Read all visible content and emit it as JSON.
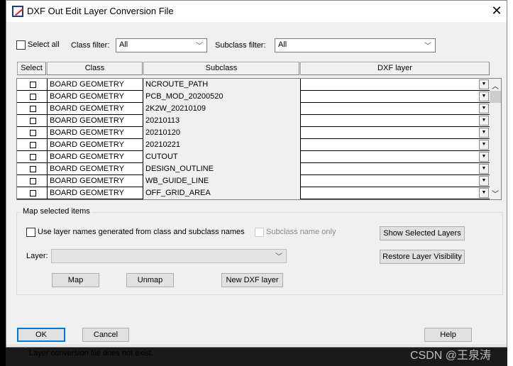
{
  "window": {
    "title": "DXF Out Edit Layer Conversion File",
    "close": "✕"
  },
  "filters": {
    "select_all": "Select all",
    "class_label": "Class filter:",
    "class_value": "All",
    "subclass_label": "Subclass filter:",
    "subclass_value": "All"
  },
  "table": {
    "headers": [
      "Select",
      "Class",
      "Subclass",
      "DXF layer"
    ],
    "rows": [
      {
        "class": "BOARD GEOMETRY",
        "subclass": "NCROUTE_PATH",
        "dxf": ""
      },
      {
        "class": "BOARD GEOMETRY",
        "subclass": "PCB_MOD_20200520",
        "dxf": ""
      },
      {
        "class": "BOARD GEOMETRY",
        "subclass": "2K2W_20210109",
        "dxf": ""
      },
      {
        "class": "BOARD GEOMETRY",
        "subclass": "20210113",
        "dxf": ""
      },
      {
        "class": "BOARD GEOMETRY",
        "subclass": "20210120",
        "dxf": ""
      },
      {
        "class": "BOARD GEOMETRY",
        "subclass": "20210221",
        "dxf": ""
      },
      {
        "class": "BOARD GEOMETRY",
        "subclass": "CUTOUT",
        "dxf": ""
      },
      {
        "class": "BOARD GEOMETRY",
        "subclass": "DESIGN_OUTLINE",
        "dxf": ""
      },
      {
        "class": "BOARD GEOMETRY",
        "subclass": "WB_GUIDE_LINE",
        "dxf": ""
      },
      {
        "class": "BOARD GEOMETRY",
        "subclass": "OFF_GRID_AREA",
        "dxf": ""
      }
    ]
  },
  "map": {
    "group_label": "Map selected items",
    "use_names": "Use layer names generated from class and subclass names",
    "subclass_only": "Subclass name only",
    "layer_label": "Layer:",
    "layer_value": "",
    "show_selected": "Show Selected Layers",
    "restore": "Restore Layer Visibility",
    "map": "Map",
    "unmap": "Unmap",
    "new_layer": "New DXF layer"
  },
  "footer": {
    "ok": "OK",
    "cancel": "Cancel",
    "help": "Help",
    "status": "Layer conversion file does not exist."
  },
  "watermark": "CSDN @王泉涛"
}
